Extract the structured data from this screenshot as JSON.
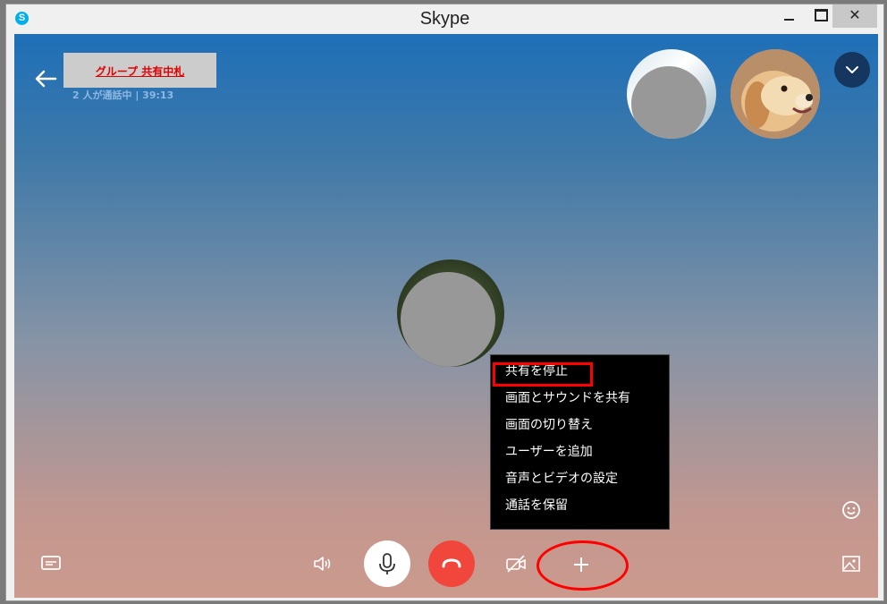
{
  "window": {
    "title": "Skype",
    "app_icon_letter": "S",
    "controls": {
      "minimize": "minimize",
      "maximize": "maximize",
      "close": "✕"
    }
  },
  "call": {
    "title": "グループ 共有中札",
    "status": "2 人が通話中 | 39:13",
    "participants": [
      "participant-1",
      "participant-2"
    ]
  },
  "share_menu": {
    "items": [
      {
        "label": "共有を停止"
      },
      {
        "label": "画面とサウンドを共有"
      },
      {
        "label": "画面の切り替え"
      },
      {
        "label": "ユーザーを追加"
      },
      {
        "label": "音声とビデオの設定"
      },
      {
        "label": "通話を保留"
      }
    ]
  },
  "controls": {
    "icons": [
      "chat-icon",
      "speaker-icon",
      "microphone-icon",
      "hang-up-icon",
      "video-off-icon",
      "plus-icon",
      "emoji-icon",
      "image-icon",
      "back-arrow-icon",
      "chevron-down-icon"
    ]
  },
  "colors": {
    "accent": "#00aff0",
    "hangup": "#f0463c",
    "annotation": "#ff0000",
    "menu_bg": "#000000"
  }
}
